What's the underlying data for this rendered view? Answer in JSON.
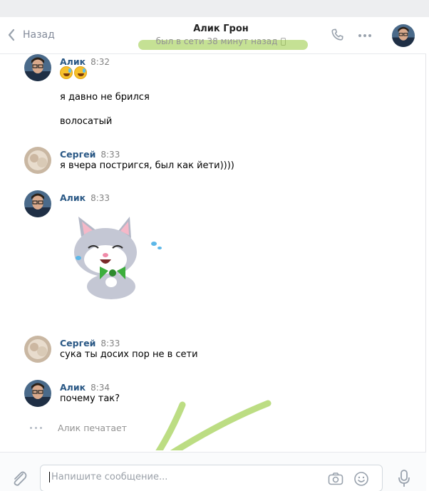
{
  "header": {
    "back_label": "Назад",
    "title": "Алик Грон",
    "status": "был в сети 38 минут назад"
  },
  "messages": [
    {
      "author": "Алик",
      "time": "8:32",
      "emoji": [
        "grinning-sweat-emoji",
        "grinning-sweat-emoji"
      ],
      "lines": [
        "я давно не брился",
        "волосатый"
      ]
    },
    {
      "author": "Сергей",
      "time": "8:33",
      "lines": [
        "я вчера постригся, был как йети))))"
      ]
    },
    {
      "author": "Алик",
      "time": "8:33",
      "sticker": "laughing-cat-sticker"
    },
    {
      "author": "Сергей",
      "time": "8:33",
      "lines": [
        "сука ты досих пор не в сети"
      ]
    },
    {
      "author": "Алик",
      "time": "8:34",
      "lines": [
        "почему так?"
      ]
    }
  ],
  "typing": "Алик печатает",
  "composer": {
    "placeholder": "Напишите сообщение..."
  },
  "colors": {
    "name_link": "#2a5885",
    "highlight": "#a6d15a",
    "icon": "#99a2ad"
  },
  "icons": [
    "back-chevron-icon",
    "phone-icon",
    "more-dots-icon",
    "paperclip-icon",
    "camera-icon",
    "smile-icon",
    "microphone-icon"
  ]
}
